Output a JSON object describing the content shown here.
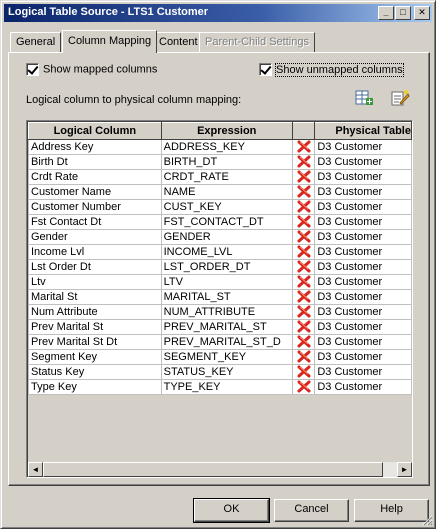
{
  "window": {
    "title": "Logical Table Source - LTS1 Customer"
  },
  "title_buttons": {
    "minimize": "_",
    "maximize": "□",
    "close": "✕"
  },
  "tabs": [
    {
      "label": "General",
      "state": "normal"
    },
    {
      "label": "Column Mapping",
      "state": "active"
    },
    {
      "label": "Content",
      "state": "normal"
    },
    {
      "label": "Parent-Child Settings",
      "state": "disabled"
    }
  ],
  "options": {
    "show_mapped": {
      "label": "Show mapped columns",
      "checked": true
    },
    "show_unmapped": {
      "label": "Show unmapped columns",
      "checked": true
    }
  },
  "mapping": {
    "heading": "Logical column to physical column mapping:",
    "tool_icons": [
      "add-mapping-icon",
      "edit-mapping-icon"
    ],
    "columns": [
      "Logical Column",
      "Expression",
      "",
      "Physical Table"
    ],
    "rows": [
      {
        "logical": "Address Key",
        "expression": "ADDRESS_KEY",
        "physical": "D3 Customer"
      },
      {
        "logical": "Birth Dt",
        "expression": "BIRTH_DT",
        "physical": "D3 Customer"
      },
      {
        "logical": "Crdt Rate",
        "expression": "CRDT_RATE",
        "physical": "D3 Customer"
      },
      {
        "logical": "Customer Name",
        "expression": "NAME",
        "physical": "D3 Customer"
      },
      {
        "logical": "Customer Number",
        "expression": "CUST_KEY",
        "physical": "D3 Customer"
      },
      {
        "logical": "Fst Contact Dt",
        "expression": "FST_CONTACT_DT",
        "physical": "D3 Customer"
      },
      {
        "logical": "Gender",
        "expression": "GENDER",
        "physical": "D3 Customer"
      },
      {
        "logical": "Income Lvl",
        "expression": "INCOME_LVL",
        "physical": "D3 Customer"
      },
      {
        "logical": "Lst Order Dt",
        "expression": "LST_ORDER_DT",
        "physical": "D3 Customer"
      },
      {
        "logical": "Ltv",
        "expression": "LTV",
        "physical": "D3 Customer"
      },
      {
        "logical": "Marital St",
        "expression": "MARITAL_ST",
        "physical": "D3 Customer"
      },
      {
        "logical": "Num Attribute",
        "expression": "NUM_ATTRIBUTE",
        "physical": "D3 Customer"
      },
      {
        "logical": "Prev Marital St",
        "expression": "PREV_MARITAL_ST",
        "physical": "D3 Customer"
      },
      {
        "logical": "Prev Marital St Dt",
        "expression": "PREV_MARITAL_ST_D",
        "physical": "D3 Customer"
      },
      {
        "logical": "Segment Key",
        "expression": "SEGMENT_KEY",
        "physical": "D3 Customer"
      },
      {
        "logical": "Status Key",
        "expression": "STATUS_KEY",
        "physical": "D3 Customer"
      },
      {
        "logical": "Type Key",
        "expression": "TYPE_KEY",
        "physical": "D3 Customer"
      }
    ],
    "delete_icon": "delete-x-icon",
    "scroll_left": "◄",
    "scroll_right": "►"
  },
  "buttons": {
    "ok": "OK",
    "cancel": "Cancel",
    "help": "Help"
  },
  "colors": {
    "title_start": "#0a246a",
    "title_end": "#a6caf0",
    "delete_red": "#d8261c",
    "face": "#d4d0c8"
  }
}
